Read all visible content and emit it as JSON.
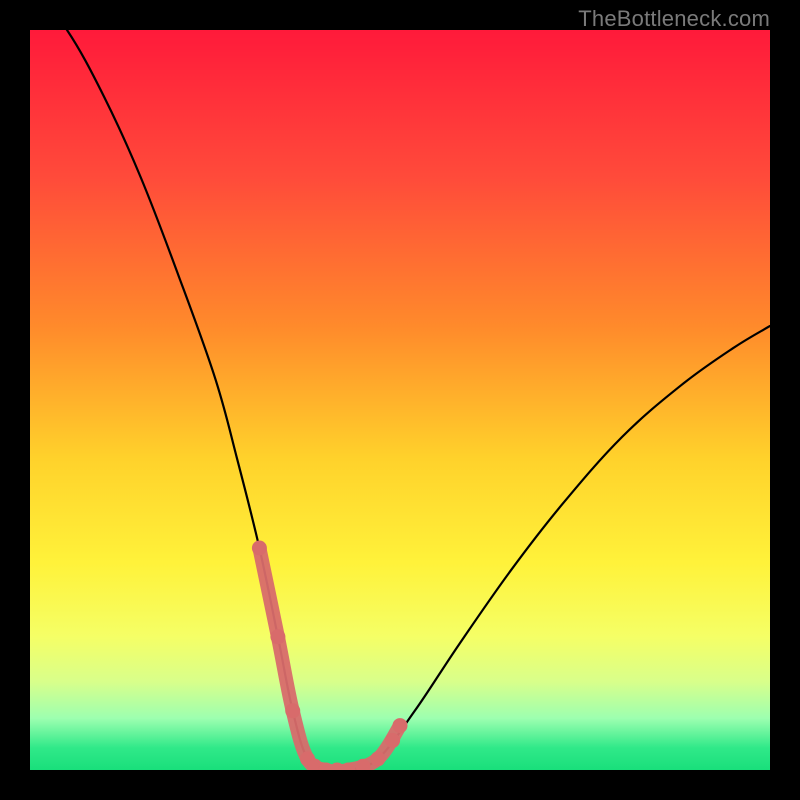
{
  "watermark": "TheBottleneck.com",
  "colors": {
    "frame": "#000000",
    "curve": "#000000",
    "highlight": "#d86b6b",
    "watermark": "#7a7a7a"
  },
  "chart_data": {
    "type": "line",
    "title": "",
    "xlabel": "",
    "ylabel": "",
    "xlim": [
      0,
      100
    ],
    "ylim": [
      0,
      100
    ],
    "background_gradient_stops": [
      {
        "offset": 0.0,
        "color": "#ff1a3a"
      },
      {
        "offset": 0.2,
        "color": "#ff4b3a"
      },
      {
        "offset": 0.4,
        "color": "#ff8a2b"
      },
      {
        "offset": 0.58,
        "color": "#ffd22b"
      },
      {
        "offset": 0.72,
        "color": "#fff23a"
      },
      {
        "offset": 0.82,
        "color": "#f5ff66"
      },
      {
        "offset": 0.88,
        "color": "#d9ff8a"
      },
      {
        "offset": 0.93,
        "color": "#9dffb0"
      },
      {
        "offset": 0.97,
        "color": "#30e989"
      },
      {
        "offset": 1.0,
        "color": "#19df7b"
      }
    ],
    "series": [
      {
        "name": "bottleneck-curve",
        "x": [
          0,
          5,
          10,
          15,
          20,
          25,
          28,
          31,
          33.5,
          35.5,
          37.5,
          40,
          43,
          47,
          52,
          58,
          65,
          72,
          80,
          88,
          95,
          100
        ],
        "values": [
          106,
          100,
          91,
          80,
          67,
          53,
          42,
          30,
          18,
          8,
          1.5,
          0,
          0,
          1.5,
          8,
          17,
          27,
          36,
          45,
          52,
          57,
          60
        ]
      }
    ],
    "highlight_region": {
      "x": [
        31,
        33.5,
        35.5,
        37.5,
        40,
        43,
        47,
        50
      ],
      "values": [
        30,
        18,
        8,
        1.5,
        0,
        0,
        1.5,
        6
      ]
    },
    "highlight_dots": {
      "x": [
        31,
        33.5,
        35.5,
        37.5,
        38.5,
        40,
        41.5,
        43,
        45,
        47,
        49,
        50
      ],
      "values": [
        30,
        18,
        8,
        1.5,
        0.5,
        0,
        0,
        0,
        0.5,
        1.5,
        4,
        6
      ]
    }
  }
}
